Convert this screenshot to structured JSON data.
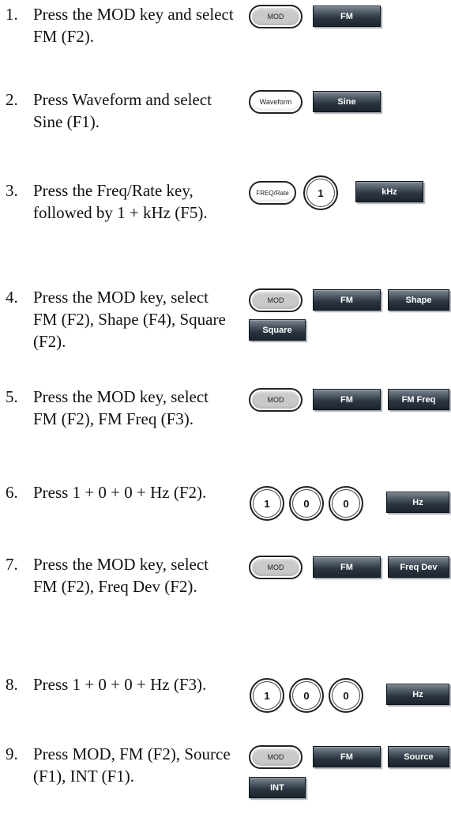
{
  "steps": [
    {
      "num": "1.",
      "text": "Press the MOD key and select FM (F2)."
    },
    {
      "num": "2.",
      "text": "Press Waveform and select Sine (F1)."
    },
    {
      "num": "3.",
      "text": "Press the Freq/Rate key, followed by 1 + kHz (F5)."
    },
    {
      "num": "4.",
      "text": "Press the MOD key, select FM (F2), Shape (F4), Square (F2)."
    },
    {
      "num": "5.",
      "text": "Press the MOD key, select FM (F2), FM Freq (F3)."
    },
    {
      "num": "6.",
      "text": "Press 1 + 0 + 0 + Hz (F2)."
    },
    {
      "num": "7.",
      "text": "Press the MOD key, select FM (F2), Freq Dev (F2)."
    },
    {
      "num": "8.",
      "text": "Press 1 + 0 + 0 + Hz (F3)."
    },
    {
      "num": "9.",
      "text": "Press MOD, FM (F2), Source (F1), INT (F1)."
    }
  ],
  "keys": {
    "mod": "MOD",
    "waveform": "Waveform",
    "freq_rate": "FREQ/Rate",
    "one": "1",
    "zero": "0",
    "fm": "FM",
    "sine": "Sine",
    "khz": "kHz",
    "shape": "Shape",
    "square": "Square",
    "fm_freq": "FM Freq",
    "hz": "Hz",
    "freq_dev": "Freq Dev",
    "source": "Source",
    "int": "INT"
  },
  "colors": {
    "softkey_dark": "#1c252e",
    "softkey_light": "#7e8892",
    "hardkey_gray": "#c9c9c9",
    "text": "#111111"
  }
}
